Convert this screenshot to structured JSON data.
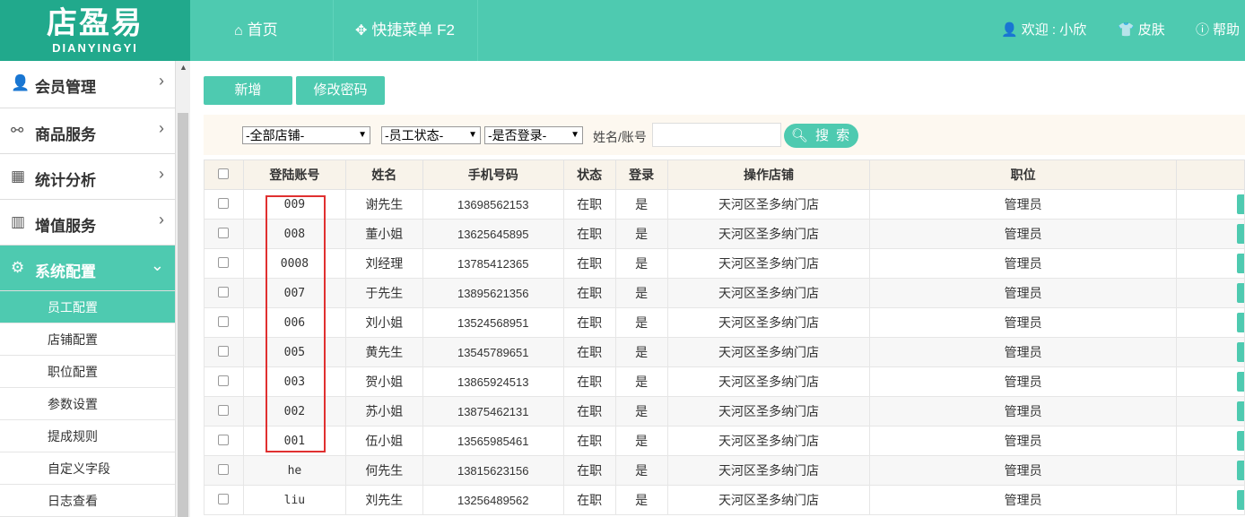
{
  "logo": {
    "cn": "店盈易",
    "en": "DIANYINGYI"
  },
  "topnav": {
    "home": "首页",
    "quick_menu": "快捷菜单 F2",
    "welcome": "欢迎 : 小欣",
    "skin": "皮肤",
    "help": "帮助"
  },
  "sidebar": {
    "menus": [
      "会员管理",
      "商品服务",
      "统计分析",
      "增值服务",
      "系统配置"
    ],
    "subitems": [
      "员工配置",
      "店铺配置",
      "职位配置",
      "参数设置",
      "提成规则",
      "自定义字段",
      "日志查看"
    ]
  },
  "toolbar": {
    "add_label": "新增",
    "change_pwd_label": "修改密码"
  },
  "filters": {
    "store": "-全部店铺-",
    "status": "-员工状态-",
    "login": "-是否登录-",
    "name_label": "姓名/账号",
    "search_label": "搜 索"
  },
  "table": {
    "headers": [
      "登陆账号",
      "姓名",
      "手机号码",
      "状态",
      "登录",
      "操作店铺",
      "职位"
    ],
    "rows": [
      [
        "009",
        "谢先生",
        "13698562153",
        "在职",
        "是",
        "天河区圣多纳门店",
        "管理员"
      ],
      [
        "008",
        "董小姐",
        "13625645895",
        "在职",
        "是",
        "天河区圣多纳门店",
        "管理员"
      ],
      [
        "0008",
        "刘经理",
        "13785412365",
        "在职",
        "是",
        "天河区圣多纳门店",
        "管理员"
      ],
      [
        "007",
        "于先生",
        "13895621356",
        "在职",
        "是",
        "天河区圣多纳门店",
        "管理员"
      ],
      [
        "006",
        "刘小姐",
        "13524568951",
        "在职",
        "是",
        "天河区圣多纳门店",
        "管理员"
      ],
      [
        "005",
        "黄先生",
        "13545789651",
        "在职",
        "是",
        "天河区圣多纳门店",
        "管理员"
      ],
      [
        "003",
        "贺小姐",
        "13865924513",
        "在职",
        "是",
        "天河区圣多纳门店",
        "管理员"
      ],
      [
        "002",
        "苏小姐",
        "13875462131",
        "在职",
        "是",
        "天河区圣多纳门店",
        "管理员"
      ],
      [
        "001",
        "伍小姐",
        "13565985461",
        "在职",
        "是",
        "天河区圣多纳门店",
        "管理员"
      ],
      [
        "he",
        "何先生",
        "13815623156",
        "在职",
        "是",
        "天河区圣多纳门店",
        "管理员"
      ],
      [
        "liu",
        "刘先生",
        "13256489562",
        "在职",
        "是",
        "天河区圣多纳门店",
        "管理员"
      ]
    ]
  },
  "colors": {
    "accent": "#4ecab0",
    "logo_bg": "#21a98c",
    "highlight": "#e03030"
  }
}
